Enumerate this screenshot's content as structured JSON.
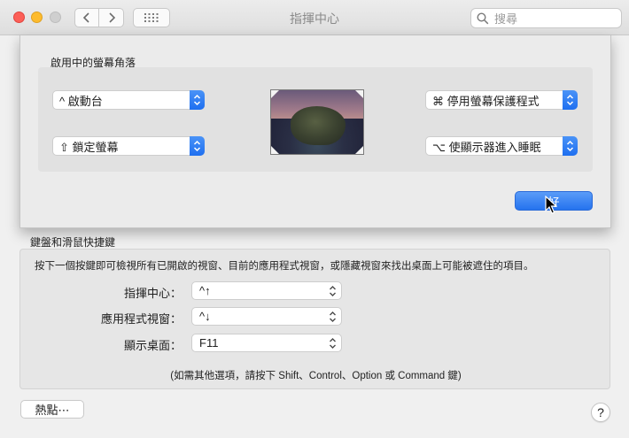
{
  "window": {
    "title": "指揮中心"
  },
  "search": {
    "placeholder": "搜尋"
  },
  "hot_corners_sheet": {
    "title": "啟用中的螢幕角落",
    "top_left": "^ 啟動台",
    "bottom_left": "⇧ 鎖定螢幕",
    "top_right": "⌘ 停用螢幕保護程式",
    "bottom_right": "⌥ 使顯示器進入睡眠",
    "ok_label": "好"
  },
  "shortcuts": {
    "section_title": "鍵盤和滑鼠快捷鍵",
    "description": "按下一個按鍵即可檢視所有已開啟的視窗、目前的應用程式視窗，或隱藏視窗來找出桌面上可能被遮住的項目。",
    "rows": [
      {
        "label": "指揮中心：",
        "value": "^↑"
      },
      {
        "label": "應用程式視窗：",
        "value": "^↓"
      },
      {
        "label": "顯示桌面：",
        "value": "F11"
      }
    ],
    "hint": "(如需其他選項，請按下 Shift、Control、Option 或 Command 鍵)"
  },
  "footer": {
    "hot_corners_button": "熱點⋯",
    "help_label": "?"
  },
  "colors": {
    "accent": "#2573ee",
    "close": "#fc5f57",
    "minimize": "#fdbb2d"
  },
  "icons": [
    "back-icon",
    "forward-icon",
    "show-all-icon",
    "search-icon",
    "updown-icon",
    "cursor-icon"
  ]
}
